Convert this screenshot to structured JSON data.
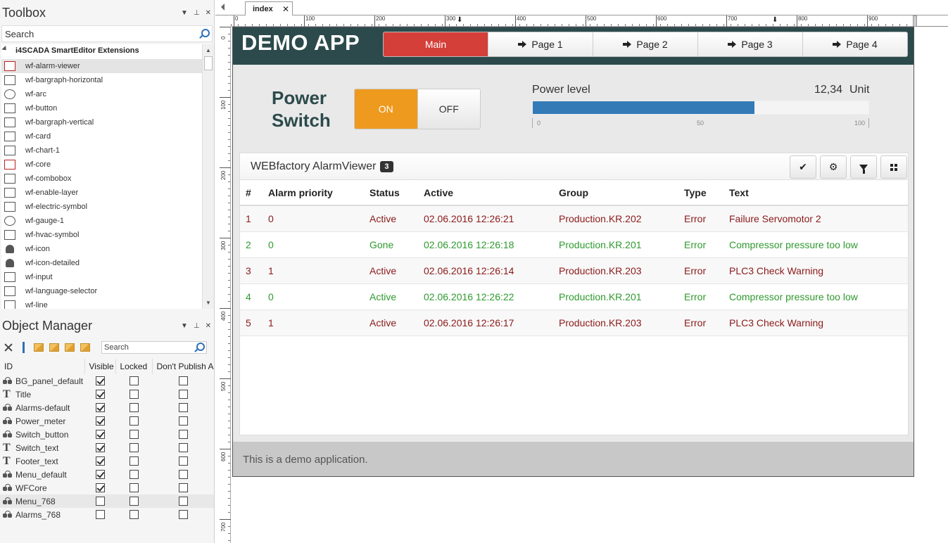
{
  "toolbox": {
    "title": "Toolbox",
    "search_placeholder": "Search",
    "group": "i4SCADA SmartEditor Extensions",
    "items": [
      {
        "label": "wf-alarm-viewer",
        "icon": "alarm-viewer-icon"
      },
      {
        "label": "wf-bargraph-horizontal",
        "icon": "bargraph-horizontal-icon"
      },
      {
        "label": "wf-arc",
        "icon": "arc-icon"
      },
      {
        "label": "wf-button",
        "icon": "button-icon"
      },
      {
        "label": "wf-bargraph-vertical",
        "icon": "bargraph-vertical-icon"
      },
      {
        "label": "wf-card",
        "icon": "card-icon"
      },
      {
        "label": "wf-chart-1",
        "icon": "chart-icon"
      },
      {
        "label": "wf-core",
        "icon": "gears-icon"
      },
      {
        "label": "wf-combobox",
        "icon": "combobox-icon"
      },
      {
        "label": "wf-enable-layer",
        "icon": "enable-layer-icon"
      },
      {
        "label": "wf-electric-symbol",
        "icon": "electric-symbol-icon"
      },
      {
        "label": "wf-gauge-1",
        "icon": "gauge-icon"
      },
      {
        "label": "wf-hvac-symbol",
        "icon": "hvac-symbol-icon"
      },
      {
        "label": "wf-icon",
        "icon": "bell-icon"
      },
      {
        "label": "wf-icon-detailed",
        "icon": "bell-icon"
      },
      {
        "label": "wf-input",
        "icon": "input-icon"
      },
      {
        "label": "wf-language-selector",
        "icon": "language-selector-icon"
      },
      {
        "label": "wf-line",
        "icon": "line-icon"
      }
    ]
  },
  "object_manager": {
    "title": "Object Manager",
    "search_placeholder": "Search",
    "columns": [
      "ID",
      "Visible",
      "Locked",
      "Don't Publish A"
    ],
    "rows": [
      {
        "id": "BG_panel_default",
        "type": "object",
        "visible": true,
        "locked": false,
        "dont_publish": false
      },
      {
        "id": "Title",
        "type": "text",
        "visible": true,
        "locked": false,
        "dont_publish": false
      },
      {
        "id": "Alarms-default",
        "type": "object",
        "visible": true,
        "locked": false,
        "dont_publish": false
      },
      {
        "id": "Power_meter",
        "type": "object",
        "visible": true,
        "locked": false,
        "dont_publish": false
      },
      {
        "id": "Switch_button",
        "type": "object",
        "visible": true,
        "locked": false,
        "dont_publish": false
      },
      {
        "id": "Switch_text",
        "type": "text",
        "visible": true,
        "locked": false,
        "dont_publish": false
      },
      {
        "id": "Footer_text",
        "type": "text",
        "visible": true,
        "locked": false,
        "dont_publish": false
      },
      {
        "id": "Menu_default",
        "type": "object",
        "visible": true,
        "locked": false,
        "dont_publish": false
      },
      {
        "id": "WFCore",
        "type": "object",
        "visible": true,
        "locked": false,
        "dont_publish": false
      },
      {
        "id": "Menu_768",
        "type": "object",
        "visible": false,
        "locked": false,
        "dont_publish": false
      },
      {
        "id": "Alarms_768",
        "type": "object",
        "visible": false,
        "locked": false,
        "dont_publish": false
      }
    ]
  },
  "designer": {
    "tab": "index",
    "ruler_labels": [
      "0",
      "100",
      "200",
      "300",
      "400",
      "500",
      "600",
      "700",
      "800",
      "900"
    ],
    "vruler_labels": [
      "0",
      "100",
      "200",
      "300",
      "400",
      "500",
      "600",
      "700"
    ]
  },
  "app": {
    "title": "DEMO APP",
    "nav": [
      "Main",
      "Page 1",
      "Page 2",
      "Page 3",
      "Page 4"
    ],
    "power_switch": {
      "label_line1": "Power",
      "label_line2": "Switch",
      "on": "ON",
      "off": "OFF"
    },
    "power_level": {
      "label": "Power level",
      "value": "12,34",
      "unit": "Unit",
      "fill_fraction": 0.66,
      "scale": [
        "0",
        "50",
        "100"
      ]
    },
    "alarm_viewer": {
      "title": "WEBfactory AlarmViewer",
      "count": "3",
      "columns": [
        "#",
        "Alarm priority",
        "Status",
        "Active",
        "Group",
        "Type",
        "Text"
      ],
      "rows": [
        {
          "num": "1",
          "priority": "0",
          "status": "Active",
          "active": "02.06.2016 12:26:21",
          "group": "Production.KR.202",
          "type": "Error",
          "text": "Failure Servomotor 2",
          "color": "#8b1a1a"
        },
        {
          "num": "2",
          "priority": "0",
          "status": "Gone",
          "active": "02.06.2016 12:26:18",
          "group": "Production.KR.201",
          "type": "Error",
          "text": "Compressor pressure too low",
          "color": "#2f9a2f"
        },
        {
          "num": "3",
          "priority": "1",
          "status": "Active",
          "active": "02.06.2016 12:26:14",
          "group": "Production.KR.203",
          "type": "Error",
          "text": "PLC3 Check Warning",
          "color": "#8b1a1a"
        },
        {
          "num": "4",
          "priority": "0",
          "status": "Active",
          "active": "02.06.2016 12:26:22",
          "group": "Production.KR.201",
          "type": "Error",
          "text": "Compressor pressure too low",
          "color": "#2f9a2f"
        },
        {
          "num": "5",
          "priority": "1",
          "status": "Active",
          "active": "02.06.2016 12:26:17",
          "group": "Production.KR.203",
          "type": "Error",
          "text": "PLC3 Check Warning",
          "color": "#8b1a1a"
        }
      ]
    },
    "footer": "This is a demo application.",
    "colors": {
      "header": "#2c4a4c",
      "nav_active": "#d43f3a",
      "switch_on": "#ee9a1f",
      "bar": "#337ab7"
    }
  }
}
